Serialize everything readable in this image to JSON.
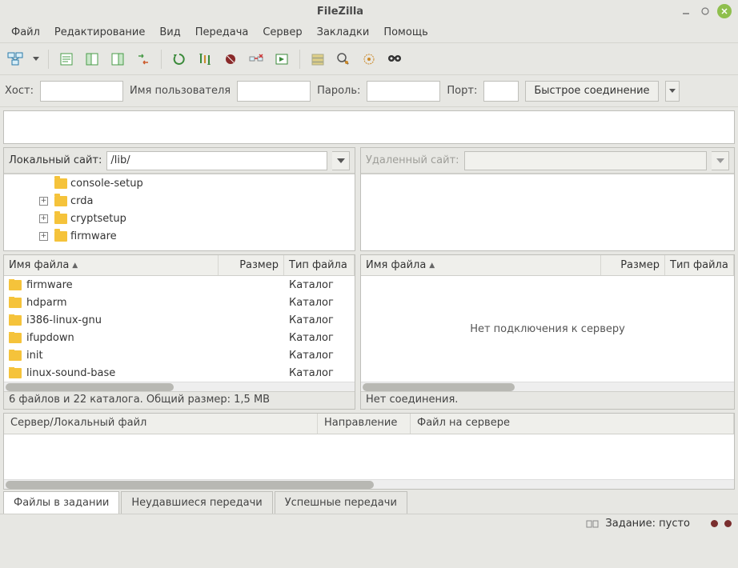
{
  "window": {
    "title": "FileZilla"
  },
  "menu": [
    "Файл",
    "Редактирование",
    "Вид",
    "Передача",
    "Сервер",
    "Закладки",
    "Помощь"
  ],
  "quickconnect": {
    "host_label": "Хост:",
    "user_label": "Имя пользователя",
    "pass_label": "Пароль:",
    "port_label": "Порт:",
    "button": "Быстрое соединение",
    "host": "",
    "user": "",
    "pass": "",
    "port": ""
  },
  "local": {
    "label": "Локальный сайт:",
    "path": "/lib/",
    "tree": [
      {
        "name": "console-setup",
        "expandable": false
      },
      {
        "name": "crda",
        "expandable": true
      },
      {
        "name": "cryptsetup",
        "expandable": true
      },
      {
        "name": "firmware",
        "expandable": true
      }
    ],
    "columns": {
      "name": "Имя файла",
      "size": "Размер",
      "type": "Тип файла"
    },
    "rows": [
      {
        "name": "firmware",
        "type": "Каталог"
      },
      {
        "name": "hdparm",
        "type": "Каталог"
      },
      {
        "name": "i386-linux-gnu",
        "type": "Каталог"
      },
      {
        "name": "ifupdown",
        "type": "Каталог"
      },
      {
        "name": "init",
        "type": "Каталог"
      },
      {
        "name": "linux-sound-base",
        "type": "Каталог"
      }
    ],
    "status": "6 файлов и 22 каталога. Общий размер: 1,5 МВ"
  },
  "remote": {
    "label": "Удаленный сайт:",
    "path": "",
    "columns": {
      "name": "Имя файла",
      "size": "Размер",
      "type": "Тип файла"
    },
    "empty": "Нет подключения к серверу",
    "status": "Нет соединения."
  },
  "queue": {
    "columns": {
      "server": "Сервер/Локальный файл",
      "direction": "Направление",
      "remote": "Файл на сервере"
    },
    "tabs": [
      "Файлы в задании",
      "Неудавшиеся передачи",
      "Успешные передачи"
    ],
    "active_tab": 0
  },
  "statusbar": {
    "queue": "Задание: пусто"
  },
  "colors": {
    "led_off": "#7a2e2e",
    "close_btn": "#8fbf4d"
  }
}
